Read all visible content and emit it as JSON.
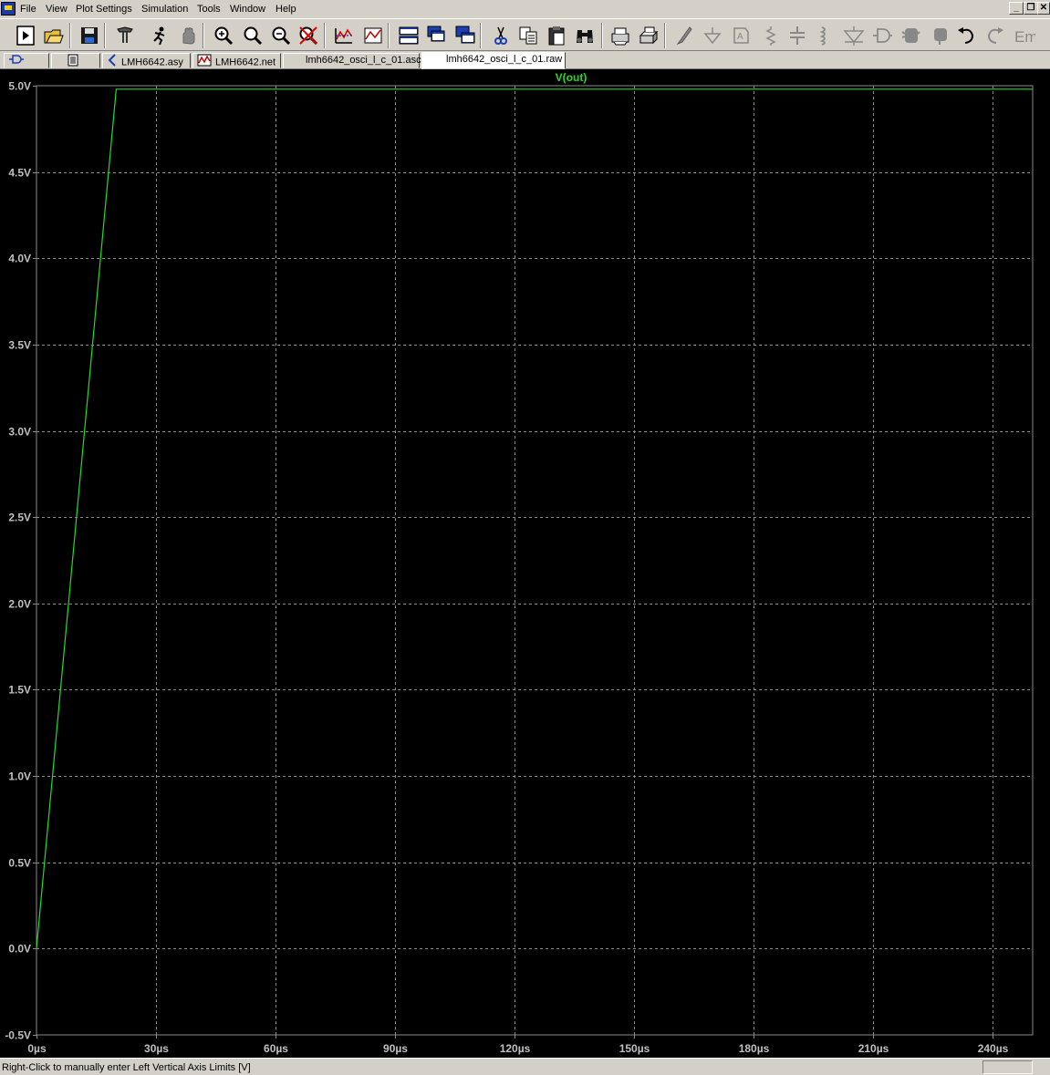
{
  "menu": {
    "items": [
      "File",
      "View",
      "Plot Settings",
      "Simulation",
      "Tools",
      "Window",
      "Help"
    ]
  },
  "toolbar": {
    "icons": [
      "run-icon",
      "open-icon",
      "save-icon",
      "control-panel-icon",
      "halt-icon",
      "pan-icon",
      "zoom-in-icon",
      "zoom-full-icon",
      "zoom-out-icon",
      "zoom-cancel-icon",
      "autorange-icon",
      "plot-pane-icon",
      "tile-horizontal-icon",
      "cascade-icon",
      "tile-vertical-icon",
      "cut-icon",
      "copy-icon",
      "paste-icon",
      "find-icon",
      "print-preview-icon",
      "print-icon",
      "wire-icon",
      "ground-icon",
      "label-icon",
      "resistor-icon",
      "capacitor-icon",
      "inductor-icon",
      "diode-icon",
      "component-icon",
      "move-icon",
      "drag-icon",
      "undo-icon",
      "redo-icon",
      "text-icon"
    ]
  },
  "tabs": [
    {
      "label": "",
      "icon": "schematic-symbol-icon"
    },
    {
      "label": "",
      "icon": "document-icon"
    },
    {
      "label": "LMH6642.asy",
      "icon": "symbol-icon"
    },
    {
      "label": "LMH6642.net",
      "icon": "netlist-icon"
    },
    {
      "label": "lmh6642_osci_l_c_01.asc",
      "icon": ""
    },
    {
      "label": "lmh6642_osci_l_c_01.raw",
      "icon": "",
      "active": true
    }
  ],
  "status": {
    "text": "Right-Click to manually enter Left Vertical Axis Limits [V]"
  },
  "colors": {
    "trace": "#22dd22",
    "grid": "#8a8a8a",
    "axis_text": "#c0c0c0",
    "background": "#000000"
  },
  "chart_data": {
    "type": "line",
    "title": "",
    "xlabel": "",
    "ylabel": "",
    "xlim": [
      0,
      250
    ],
    "ylim": [
      -0.5,
      5.0
    ],
    "grid": true,
    "x_ticks": [
      0,
      30,
      60,
      90,
      120,
      150,
      180,
      210,
      240
    ],
    "x_tick_labels": [
      "0µs",
      "30µs",
      "60µs",
      "90µs",
      "120µs",
      "150µs",
      "180µs",
      "210µs",
      "240µs"
    ],
    "y_ticks": [
      -0.5,
      0.0,
      0.5,
      1.0,
      1.5,
      2.0,
      2.5,
      3.0,
      3.5,
      4.0,
      4.5,
      5.0
    ],
    "y_tick_labels": [
      "-0.5V",
      "0.0V",
      "0.5V",
      "1.0V",
      "1.5V",
      "2.0V",
      "2.5V",
      "3.0V",
      "3.5V",
      "4.0V",
      "4.5V",
      "5.0V"
    ],
    "series": [
      {
        "name": "V(out)",
        "x": [
          0,
          20,
          250
        ],
        "y": [
          0.0,
          4.98,
          4.98
        ]
      }
    ]
  }
}
